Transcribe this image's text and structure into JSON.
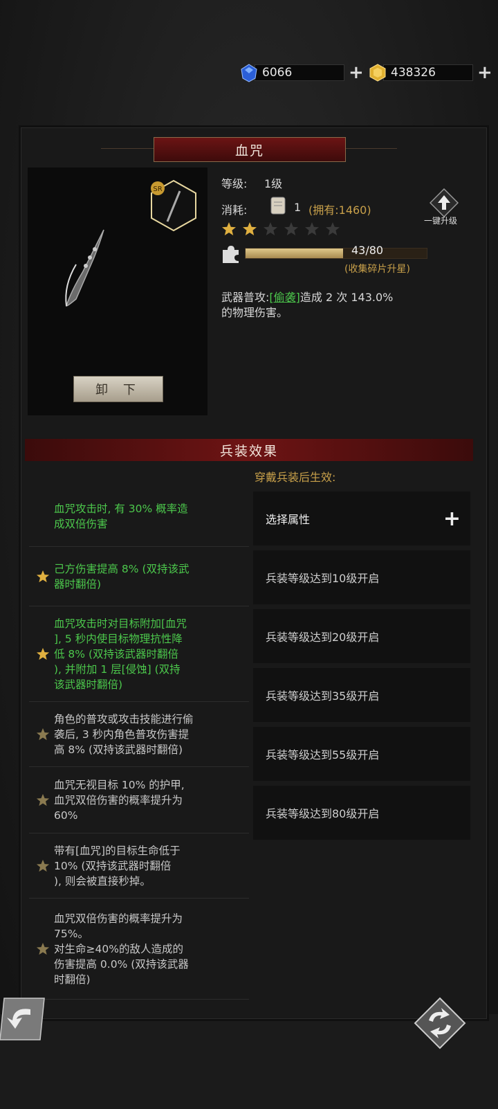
{
  "currency": {
    "gems": "6066",
    "gold": "438326"
  },
  "weapon": {
    "name": "血咒",
    "rarity_badge": "SR",
    "unequip_label": "卸 下",
    "level_label": "等级:",
    "level_value": "1级",
    "cost_label": "消耗:",
    "cost_value": "1",
    "owned": "(拥有:1460)",
    "upgrade_label": "一键升级",
    "stars_filled": 2,
    "stars_total": 6,
    "shard_progress": "43/80",
    "shard_fraction": 0.5375,
    "shard_hint": "(收集碎片升星)",
    "attack_prefix": "武器普攻:",
    "attack_skill": "[偷袭]",
    "attack_suffix": "造成 2 次 143.0%",
    "attack_line2": "的物理伤害。"
  },
  "effects_section": {
    "title": "兵装效果",
    "note": "穿戴兵装后生效:",
    "effects": [
      {
        "lines": [
          "血咒攻击时, 有 30% 概率造",
          "成双倍伤害"
        ],
        "active": true,
        "star": false
      },
      {
        "lines": [
          "己方伤害提高 8% (双持该武",
          "器时翻倍)"
        ],
        "active": true,
        "star": true
      },
      {
        "lines": [
          "血咒攻击时对目标附加[血咒",
          "], 5 秒内使目标物理抗性降",
          "低 8% (双持该武器时翻倍",
          "), 并附加 1 层[侵蚀] (双持",
          "该武器时翻倍)"
        ],
        "active": true,
        "star": true
      },
      {
        "lines": [
          "角色的普攻或攻击技能进行偷",
          "袭后, 3 秒内角色普攻伤害提",
          "高 8% (双持该武器时翻倍)"
        ],
        "active": false,
        "star": true
      },
      {
        "lines": [
          "血咒无视目标 10% 的护甲,",
          "血咒双倍伤害的概率提升为",
          "60%"
        ],
        "active": false,
        "star": true
      },
      {
        "lines": [
          "带有[血咒]的目标生命低于",
          "10% (双持该武器时翻倍",
          "), 则会被直接秒掉。"
        ],
        "active": false,
        "star": true
      },
      {
        "lines": [
          "血咒双倍伤害的概率提升为",
          "75%。",
          "对生命≥40%的敌人造成的",
          "伤害提高 0.0% (双持该武器",
          "时翻倍)"
        ],
        "active": false,
        "star": true
      }
    ],
    "slots": [
      "选择属性",
      "兵装等级达到10级开启",
      "兵装等级达到20级开启",
      "兵装等级达到35级开启",
      "兵装等级达到55级开启",
      "兵装等级达到80级开启"
    ]
  },
  "colors": {
    "active_text": "#4cc84c",
    "inactive_text": "#c8c8c8",
    "accent_gold": "#c8a04a",
    "title_red": "#6b1414"
  }
}
